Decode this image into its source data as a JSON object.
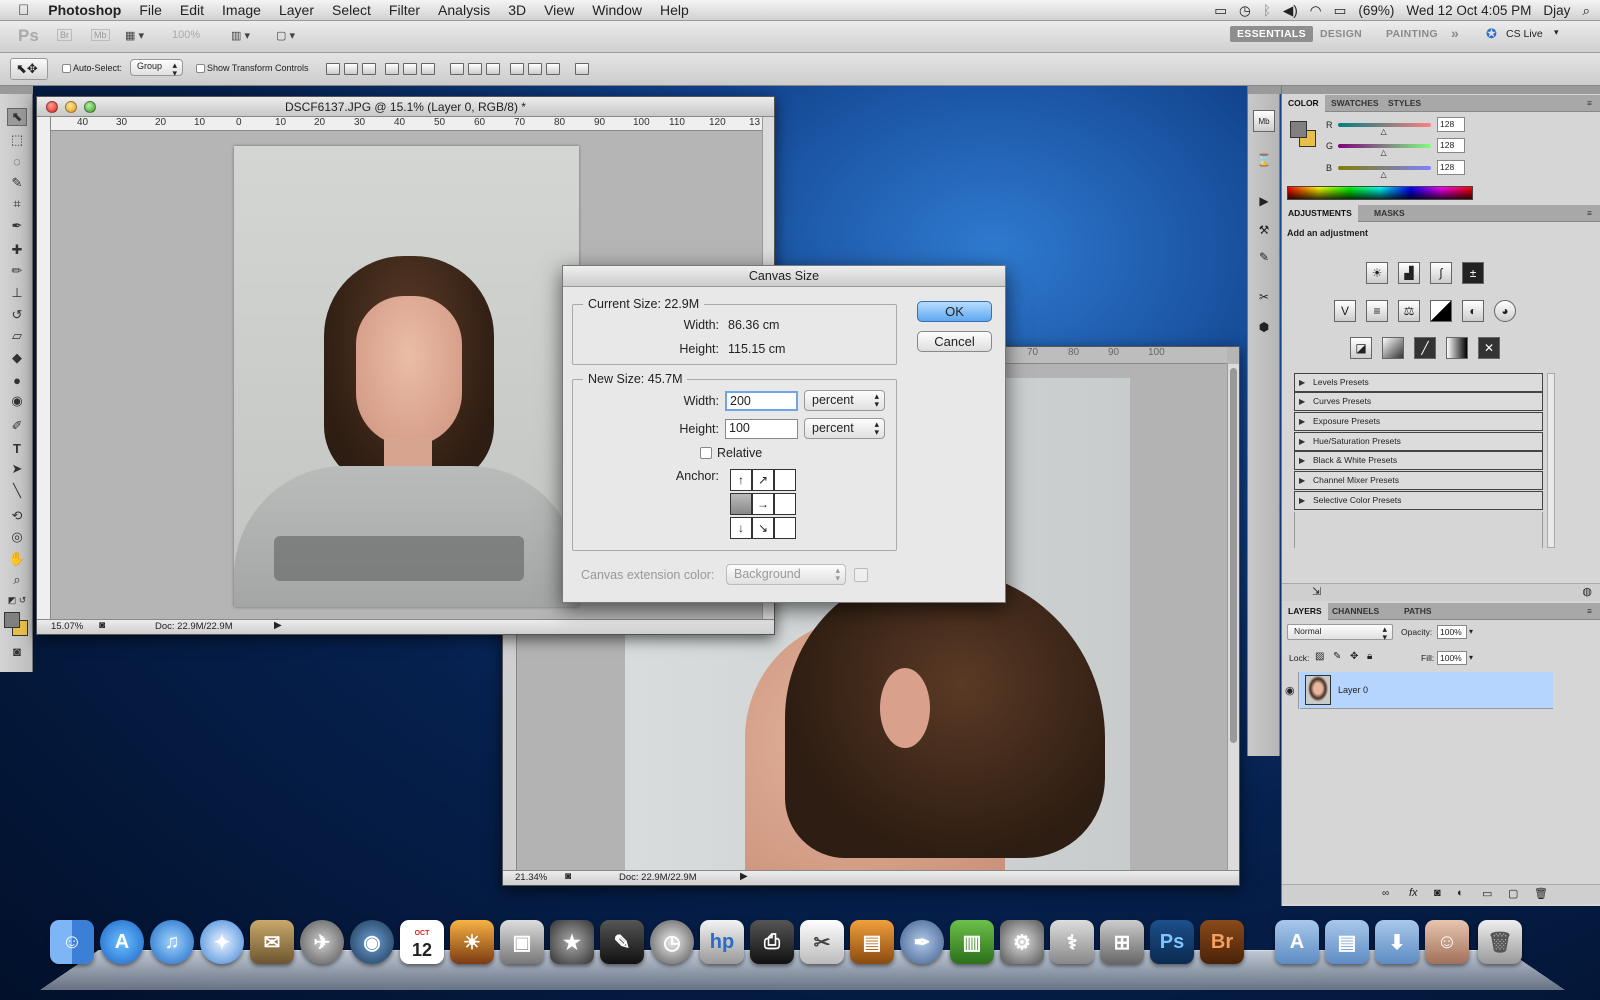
{
  "menubar": {
    "apple": "",
    "app": "Photoshop",
    "items": [
      "File",
      "Edit",
      "Image",
      "Layer",
      "Select",
      "Filter",
      "Analysis",
      "3D",
      "View",
      "Window",
      "Help"
    ],
    "battery": "(69%)",
    "clock": "Wed 12 Oct  4:05 PM",
    "user": "Djay"
  },
  "appbar": {
    "ps": "Ps",
    "br": "Br",
    "mb": "Mb",
    "zoom": "100%",
    "workspaces": [
      "ESSENTIALS",
      "DESIGN",
      "PAINTING"
    ],
    "more": "»",
    "cslive": "CS Live"
  },
  "options": {
    "auto_select": "Auto-Select:",
    "group": "Group",
    "show_transform": "Show Transform Controls"
  },
  "doc1": {
    "title": "DSCF6137.JPG @ 15.1% (Layer 0, RGB/8) *",
    "zoom": "15.07%",
    "docsize": "Doc: 22.9M/22.9M",
    "ruler": [
      "40",
      "30",
      "20",
      "10",
      "0",
      "10",
      "20",
      "30",
      "40",
      "50",
      "60",
      "70",
      "80",
      "90",
      "100",
      "110",
      "120",
      "13"
    ]
  },
  "doc2": {
    "zoom": "21.34%",
    "docsize": "Doc: 22.9M/22.9M",
    "ruler": [
      "70",
      "80",
      "90",
      "100"
    ]
  },
  "dialog": {
    "title": "Canvas Size",
    "current_legend": "Current Size: 22.9M",
    "width_label": "Width:",
    "width_value": "86.36 cm",
    "height_label": "Height:",
    "height_value": "115.15 cm",
    "new_legend": "New Size: 45.7M",
    "new_width": "200",
    "new_height": "100",
    "unit_w": "percent",
    "unit_h": "percent",
    "relative": "Relative",
    "anchor": "Anchor:",
    "ext_label": "Canvas extension color:",
    "ext_value": "Background",
    "ok": "OK",
    "cancel": "Cancel"
  },
  "color_panel": {
    "tabs": [
      "COLOR",
      "SWATCHES",
      "STYLES"
    ],
    "r_label": "R",
    "g_label": "G",
    "b_label": "B",
    "r": "128",
    "g": "128",
    "b": "128",
    "r_level": 0.5,
    "g_level": 0.5,
    "b_level": 0.5,
    "fg": "#808080",
    "bg": "#e8c048"
  },
  "adjust_panel": {
    "tabs": [
      "ADJUSTMENTS",
      "MASKS"
    ],
    "heading": "Add an adjustment",
    "presets": [
      "Levels Presets",
      "Curves Presets",
      "Exposure Presets",
      "Hue/Saturation Presets",
      "Black & White Presets",
      "Channel Mixer Presets",
      "Selective Color Presets"
    ]
  },
  "layers_panel": {
    "tabs": [
      "LAYERS",
      "CHANNELS",
      "PATHS"
    ],
    "blend": "Normal",
    "opacity_label": "Opacity:",
    "opacity": "100%",
    "lock_label": "Lock:",
    "fill_label": "Fill:",
    "fill": "100%",
    "layer_name": "Layer 0"
  },
  "dock": {
    "calendar_month": "OCT",
    "calendar_day": "12",
    "ps": "Ps",
    "br": "Br"
  }
}
